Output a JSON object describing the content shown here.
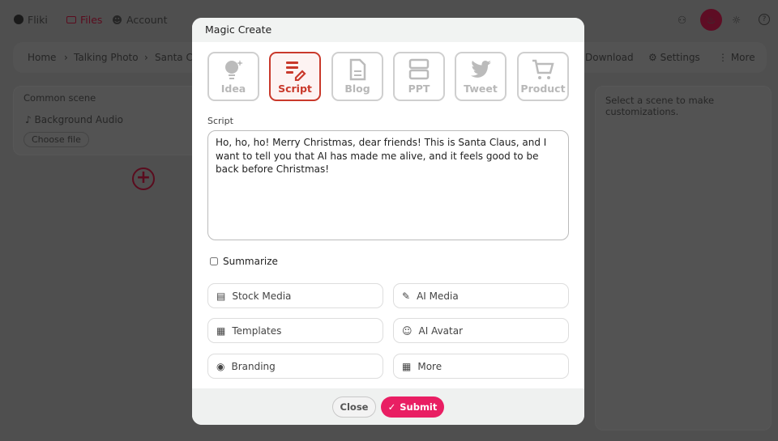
{
  "nav": {
    "brand": "Fliki",
    "files": "Files",
    "account": "Account"
  },
  "breadcrumb": {
    "items": [
      "Home",
      "Talking Photo",
      "Santa Cl"
    ],
    "download": "Download",
    "settings": "Settings",
    "more": "More"
  },
  "left_panel": {
    "title": "Common scene",
    "audio": "Background Audio",
    "choose_file": "Choose file"
  },
  "right_panel": {
    "hint": "Select a scene to make customizations."
  },
  "modal": {
    "title": "Magic Create",
    "tabs": [
      {
        "label": "Idea",
        "icon": "lightbulb-icon"
      },
      {
        "label": "Script",
        "icon": "script-edit-icon",
        "active": true
      },
      {
        "label": "Blog",
        "icon": "document-icon"
      },
      {
        "label": "PPT",
        "icon": "slides-icon"
      },
      {
        "label": "Tweet",
        "icon": "twitter-icon"
      },
      {
        "label": "Product",
        "icon": "cart-icon"
      }
    ],
    "script_label": "Script",
    "script_value": "Ho, ho, ho! Merry Christmas, dear friends! This is Santa Claus, and I want to tell you that AI has made me alive, and it feels good to be back before Christmas!",
    "summarize_label": "Summarize",
    "summarize_checked": false,
    "options": [
      {
        "label": "Stock Media"
      },
      {
        "label": "AI Media"
      },
      {
        "label": "Templates"
      },
      {
        "label": "AI Avatar"
      },
      {
        "label": "Branding"
      },
      {
        "label": "More"
      }
    ],
    "close": "Close",
    "submit": "Submit"
  },
  "colors": {
    "accent": "#c9392b",
    "submit": "#e91e63",
    "avatar": "#7a1030"
  }
}
